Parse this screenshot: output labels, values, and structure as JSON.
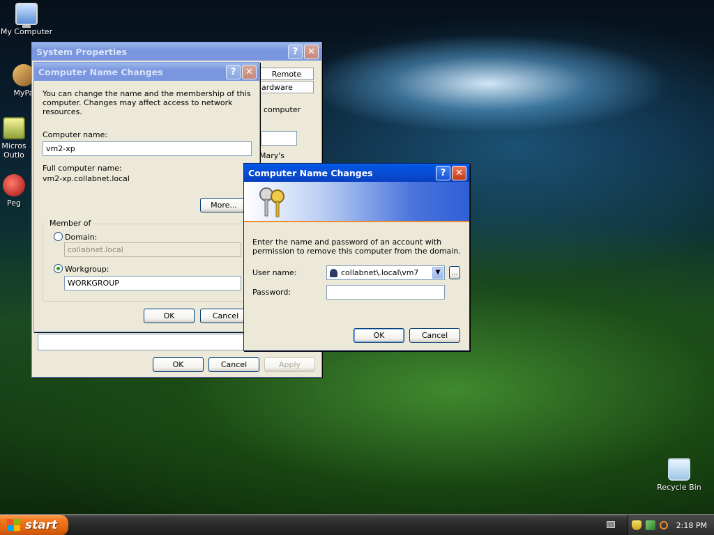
{
  "desktop": {
    "icons": [
      {
        "label": "My Computer"
      },
      {
        "label": "MyPa"
      },
      {
        "label": "Micros Outlo"
      },
      {
        "label": "Peg"
      },
      {
        "label": "Recycle Bin"
      }
    ]
  },
  "system_properties": {
    "title": "System Properties",
    "tabs": [
      "Remote",
      "ardware"
    ],
    "partial_text": [
      "computer",
      "Mary's"
    ],
    "buttons": {
      "ok": "OK",
      "cancel": "Cancel",
      "apply": "Apply"
    }
  },
  "name_changes": {
    "title": "Computer Name Changes",
    "intro": "You can change the name and the membership of this computer. Changes may affect access to network resources.",
    "computer_name_label": "Computer name:",
    "computer_name_value": "vm2-xp",
    "full_name_label": "Full computer name:",
    "full_name_value": "vm2-xp.collabnet.local",
    "more_button": "More...",
    "member_of_label": "Member of",
    "domain_label": "Domain:",
    "domain_value": "collabnet.local",
    "workgroup_label": "Workgroup:",
    "workgroup_value": "WORKGROUP",
    "selected_membership": "workgroup",
    "ok": "OK",
    "cancel": "Cancel"
  },
  "credentials": {
    "title": "Computer Name Changes",
    "instructions": "Enter the name and password of an account with permission to remove this computer from the domain.",
    "username_label": "User name:",
    "username_value": "collabnet\\.local\\vm7",
    "password_label": "Password:",
    "password_value": "",
    "browse_button": "...",
    "ok": "OK",
    "cancel": "Cancel"
  },
  "taskbar": {
    "start_label": "start",
    "clock": "2:18 PM"
  },
  "colors": {
    "titlebar_active": "#0054e3",
    "titlebar_inactive": "#7a96df",
    "dialog_face": "#ece9d8",
    "start_button": "#e0620d",
    "close_button": "#c43a17"
  }
}
